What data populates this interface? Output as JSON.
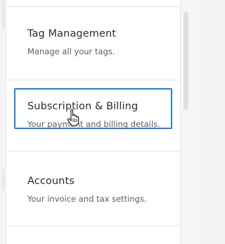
{
  "menu": {
    "items": [
      {
        "title": "Tag Management",
        "description": "Manage all your tags."
      },
      {
        "title": "Subscription & Billing",
        "description": "Your payment and billing details.",
        "selected": true
      },
      {
        "title": "Accounts",
        "description": "Your invoice and tax settings."
      }
    ]
  },
  "cursor": {
    "type": "hand-pointer-icon"
  },
  "colors": {
    "selection_border": "#1e7ff2",
    "title_text": "#2d2d2d",
    "description_text": "#5d5d5d",
    "panel_background": "#ffffff",
    "page_background": "#f4f4f4"
  }
}
